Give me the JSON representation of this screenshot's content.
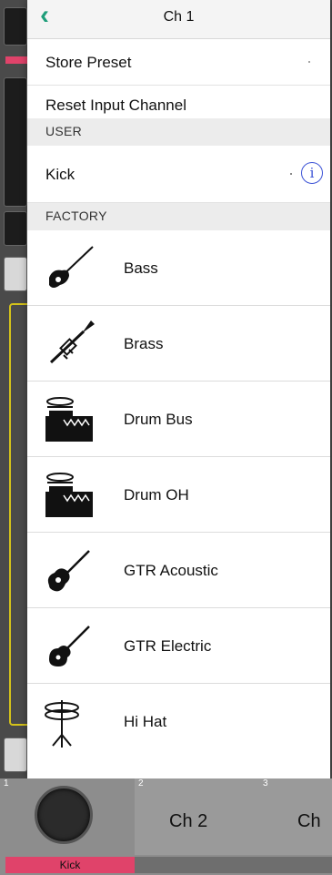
{
  "header": {
    "title": "Ch 1",
    "back_icon": "chevron-left-icon"
  },
  "actions": [
    {
      "label": "Store Preset"
    },
    {
      "label": "Reset Input Channel"
    }
  ],
  "user_section": {
    "title": "USER",
    "items": [
      {
        "label": "Kick",
        "info_icon": "info-icon",
        "info_symbol": "i"
      }
    ]
  },
  "factory_section": {
    "title": "FACTORY",
    "items": [
      {
        "label": "Bass",
        "icon": "bass-guitar-icon"
      },
      {
        "label": "Brass",
        "icon": "trumpet-icon"
      },
      {
        "label": "Drum Bus",
        "icon": "drum-icon"
      },
      {
        "label": "Drum OH",
        "icon": "drum-icon"
      },
      {
        "label": "GTR Acoustic",
        "icon": "acoustic-guitar-icon"
      },
      {
        "label": "GTR Electric",
        "icon": "electric-guitar-icon"
      },
      {
        "label": "Hi Hat",
        "icon": "hi-hat-icon"
      }
    ]
  },
  "channels": [
    {
      "number": "1",
      "name": "Kick"
    },
    {
      "number": "2",
      "name": "Ch 2"
    },
    {
      "number": "3",
      "name": "Ch"
    }
  ],
  "colors": {
    "accent": "#1f9e7a",
    "channel_red": "#e0436a",
    "info_blue": "#3b52d6",
    "highlight_yellow": "#d4c21a"
  }
}
